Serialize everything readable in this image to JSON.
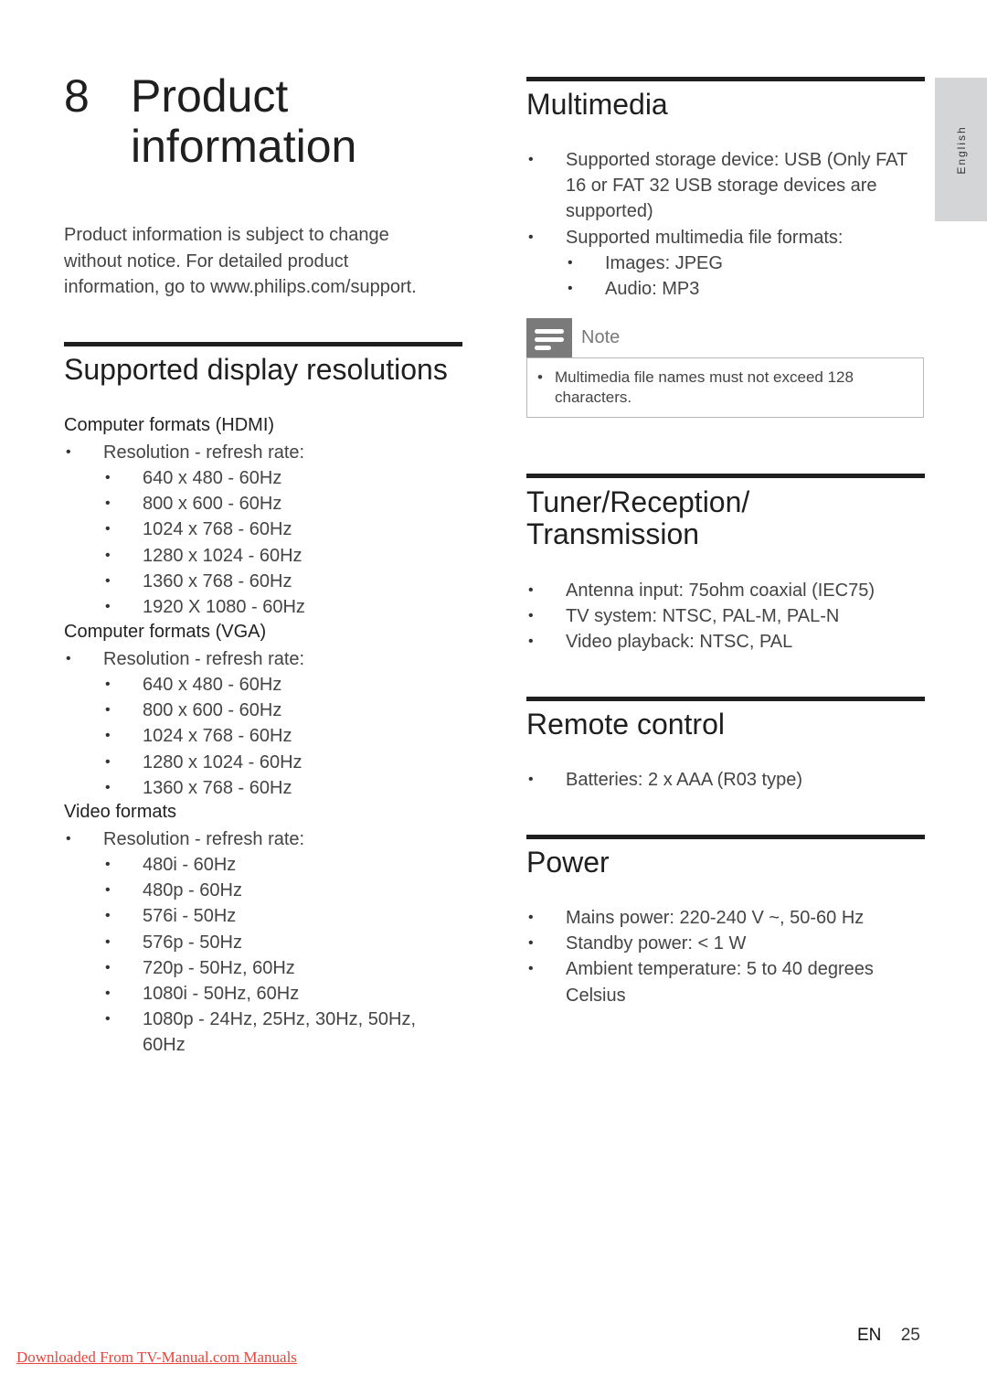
{
  "chapter": {
    "number": "8",
    "title": "Product information"
  },
  "intro": "Product information is subject to change without notice. For detailed product information, go to www.philips.com/support.",
  "display_resolutions": {
    "title": "Supported display resolutions",
    "groups": [
      {
        "heading": "Computer formats (HDMI)",
        "item": "Resolution - refresh rate:",
        "values": [
          "640 x 480 - 60Hz",
          "800 x 600 - 60Hz",
          "1024 x 768 - 60Hz",
          "1280 x 1024 - 60Hz",
          "1360 x 768 - 60Hz",
          "1920 X 1080 - 60Hz"
        ]
      },
      {
        "heading": "Computer formats (VGA)",
        "item": "Resolution - refresh rate:",
        "values": [
          "640 x 480 - 60Hz",
          "800 x 600 - 60Hz",
          "1024 x 768 - 60Hz",
          "1280 x 1024 - 60Hz",
          "1360 x 768 - 60Hz"
        ]
      },
      {
        "heading": "Video formats",
        "item": "Resolution - refresh rate:",
        "values": [
          "480i - 60Hz",
          "480p - 60Hz",
          "576i - 50Hz",
          "576p - 50Hz",
          "720p - 50Hz, 60Hz",
          "1080i - 50Hz, 60Hz",
          "1080p - 24Hz, 25Hz, 30Hz, 50Hz, 60Hz"
        ]
      }
    ]
  },
  "multimedia": {
    "title": "Multimedia",
    "items": [
      "Supported storage device: USB (Only FAT 16 or FAT 32 USB storage devices are supported)",
      "Supported multimedia file formats:"
    ],
    "formats": [
      "Images: JPEG",
      "Audio: MP3"
    ],
    "note": {
      "label": "Note",
      "text": "Multimedia file names must not exceed 128 characters."
    }
  },
  "tuner": {
    "title_line1": "Tuner/Reception/",
    "title_line2": "Transmission",
    "items": [
      "Antenna input: 75ohm coaxial (IEC75)",
      "TV system: NTSC, PAL-M, PAL-N",
      "Video playback: NTSC, PAL"
    ]
  },
  "remote": {
    "title": "Remote control",
    "items": [
      "Batteries: 2 x AAA (R03 type)"
    ]
  },
  "power": {
    "title": "Power",
    "items": [
      "Mains power: 220-240 V ~, 50-60 Hz",
      "Standby power: < 1 W",
      "Ambient temperature: 5 to 40 degrees Celsius"
    ]
  },
  "side_tab": "English",
  "footer": {
    "lang": "EN",
    "page": "25",
    "link": "Downloaded From TV-Manual.com Manuals"
  }
}
